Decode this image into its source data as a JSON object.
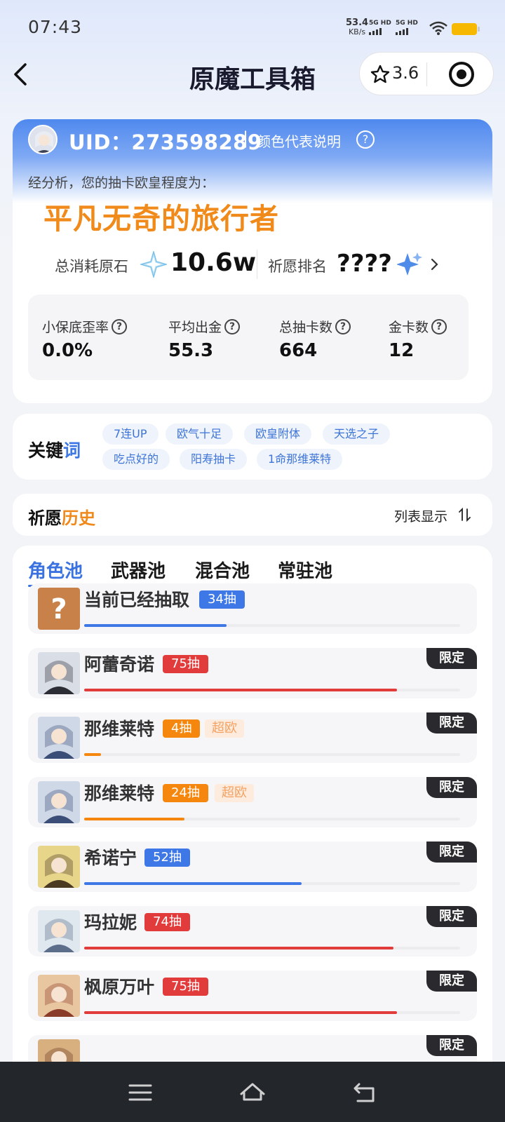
{
  "status_bar": {
    "time": "07:43",
    "net_speed_value": "53.4",
    "net_speed_unit": "KB/s",
    "sim1": "5G HD",
    "sim2": "5G HD",
    "battery_color": "#f6b800"
  },
  "header": {
    "title": "原魔工具箱",
    "rating": "3.6"
  },
  "summary": {
    "uid": "UID：273598289",
    "separator": "|",
    "color_legend": "颜色代表说明",
    "analysis_label": "经分析，您的抽卡欧皇程度为：",
    "luck_title": "平凡无奇的旅行者",
    "spent_label": "总消耗原石",
    "spent_value": "10.6w",
    "rank_label": "祈愿排名",
    "rank_value": "????",
    "stats": [
      {
        "label": "小保底歪率",
        "value": "0.0%"
      },
      {
        "label": "平均出金",
        "value": "55.3"
      },
      {
        "label": "总抽卡数",
        "value": "664"
      },
      {
        "label": "金卡数",
        "value": "12"
      }
    ]
  },
  "keywords": {
    "title_a": "关键",
    "title_b": "词",
    "items": [
      "7连UP",
      "欧气十足",
      "欧皇附体",
      "天选之子",
      "吃点好的",
      "阳寿抽卡",
      "1命那维莱特"
    ]
  },
  "history": {
    "title_a": "祈愿",
    "title_b": "历史",
    "view_mode": "列表显示"
  },
  "pools": {
    "tabs": [
      "角色池",
      "武器池",
      "混合池",
      "常驻池"
    ],
    "active_tab": "角色池",
    "rows": [
      {
        "name": "当前已经抽取",
        "pulls": "34抽",
        "color": "#3e78e6",
        "progress": 0.378,
        "tag": "",
        "limited": ""
      },
      {
        "name": "阿蕾奇诺",
        "pulls": "75抽",
        "color": "#e23b3b",
        "progress": 0.833,
        "tag": "",
        "limited": "限定"
      },
      {
        "name": "那维莱特",
        "pulls": "4抽",
        "color": "#f5870f",
        "progress": 0.044,
        "tag": "超欧",
        "limited": "限定"
      },
      {
        "name": "那维莱特",
        "pulls": "24抽",
        "color": "#f5870f",
        "progress": 0.267,
        "tag": "超欧",
        "limited": "限定"
      },
      {
        "name": "希诺宁",
        "pulls": "52抽",
        "color": "#3e78e6",
        "progress": 0.578,
        "tag": "",
        "limited": "限定"
      },
      {
        "name": "玛拉妮",
        "pulls": "74抽",
        "color": "#e23b3b",
        "progress": 0.822,
        "tag": "",
        "limited": "限定"
      },
      {
        "name": "枫原万叶",
        "pulls": "75抽",
        "color": "#e23b3b",
        "progress": 0.833,
        "tag": "",
        "limited": "限定"
      },
      {
        "name": "",
        "pulls": "",
        "color": "#e23b3b",
        "progress": 0,
        "tag": "",
        "limited": "限定"
      }
    ]
  },
  "nav": {
    "icons": [
      "menu-icon",
      "home-icon",
      "back-icon"
    ]
  }
}
